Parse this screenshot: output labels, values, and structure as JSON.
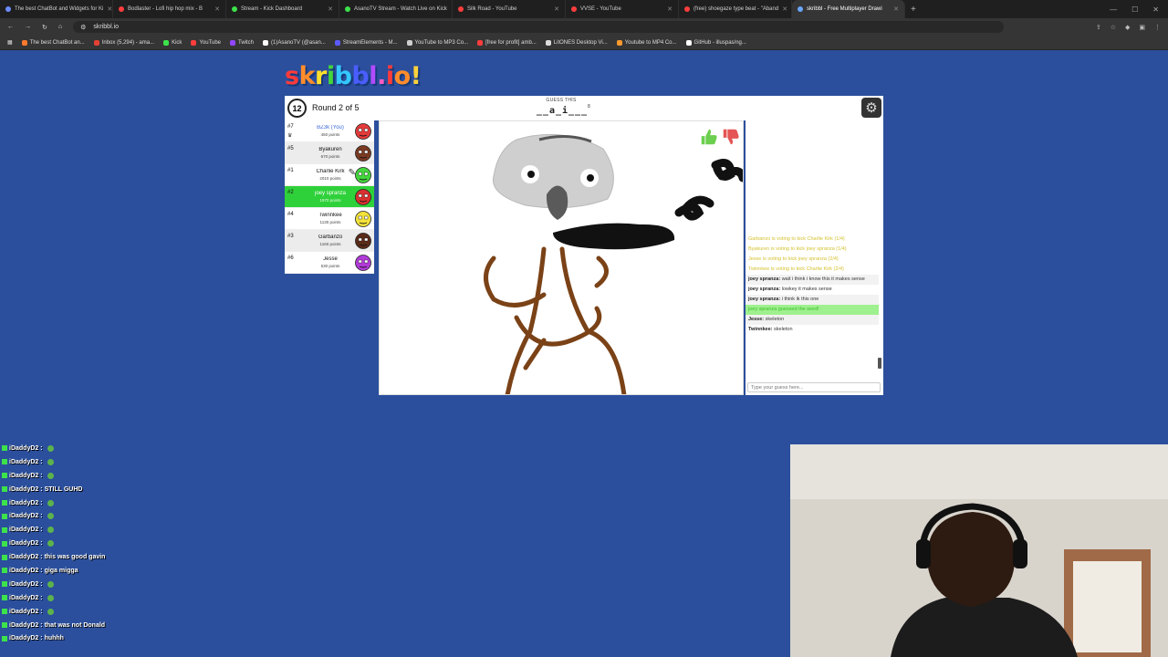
{
  "browser": {
    "tabs": [
      {
        "label": "The best ChatBot and Widgets for Ki",
        "color": "#6c8cff"
      },
      {
        "label": "Bodlaster - Lofi hip hop mix - B",
        "color": "#ff3d3d"
      },
      {
        "label": "Stream - Kick Dashboard",
        "color": "#3de24b"
      },
      {
        "label": "AsanoTV Stream - Watch Live on Kick",
        "color": "#3de24b"
      },
      {
        "label": "Silk Road - YouTube",
        "color": "#ff3d3d"
      },
      {
        "label": "VVSE - YouTube",
        "color": "#ff3d3d"
      },
      {
        "label": "(free) shoegaze type beat - \"Aband",
        "color": "#ff3d3d"
      },
      {
        "label": "skribbl - Free Multiplayer Drawi",
        "color": "#6aa7ff"
      }
    ],
    "url": "skribbl.io",
    "bookmarks": [
      {
        "label": "The best ChatBot an...",
        "color": "#ff7a2f"
      },
      {
        "label": "Inbox (5,294) - ama...",
        "color": "#e34133"
      },
      {
        "label": "Kick",
        "color": "#3de24b"
      },
      {
        "label": "YouTube",
        "color": "#ff3d3d"
      },
      {
        "label": "Twitch",
        "color": "#9146ff"
      },
      {
        "label": "(1)AsanoTV (@asan...",
        "color": "#ffffff"
      },
      {
        "label": "StreamElements - M...",
        "color": "#5b5bff"
      },
      {
        "label": "YouTube to MP3 Co...",
        "color": "#cfcfcf"
      },
      {
        "label": "[free for profit] amb...",
        "color": "#ff3d3d"
      },
      {
        "label": "LitONES Desktop Vi...",
        "color": "#dddddd"
      },
      {
        "label": "Youtube to MP4 Co...",
        "color": "#ff9a2f"
      },
      {
        "label": "GitHub - illuspas/ng...",
        "color": "#ffffff"
      }
    ]
  },
  "game": {
    "logo": "skribbl.io",
    "logo_suffix": "!",
    "logo_colors": [
      "#ff3b3b",
      "#ff8c2b",
      "#ffe02b",
      "#43d63c",
      "#34c7ff",
      "#4a5dff",
      "#b14bff",
      "#ff5cc4",
      "#ff3b3b",
      "#ff8c2b"
    ],
    "timer": "12",
    "round": "Round 2 of 5",
    "guess_label": "GUESS THIS",
    "guess_word": "__a_i___",
    "word_length": "8",
    "players": [
      {
        "rank": "#7",
        "name": "BZ3k (You)",
        "points": "450 points",
        "avatar_color": "#e43b3b",
        "me": true
      },
      {
        "rank": "#5",
        "name": "Byakuren",
        "points": "670 points",
        "avatar_color": "#7a3b22"
      },
      {
        "rank": "#1",
        "name": "Charlie Kirk",
        "points": "2010 points",
        "avatar_color": "#43d63c",
        "drawing": true
      },
      {
        "rank": "#2",
        "name": "joey spranza",
        "points": "1970 points",
        "avatar_color": "#d93030",
        "guessed": true
      },
      {
        "rank": "#4",
        "name": "Twinnkee",
        "points": "1130 points",
        "avatar_color": "#f2e23a"
      },
      {
        "rank": "#3",
        "name": "Garbanzo",
        "points": "1160 points",
        "avatar_color": "#5a2b19"
      },
      {
        "rank": "#6",
        "name": "Jesse",
        "points": "530 points",
        "avatar_color": "#b23ad9"
      }
    ],
    "chat": [
      {
        "type": "system",
        "text": "Garbanzo is voting to kick Charlie Kirk (1/4)"
      },
      {
        "type": "system",
        "text": "Byakuren is voting to kick joey spranza (1/4)"
      },
      {
        "type": "system",
        "text": "Jesse is voting to kick joey spranza (2/4)"
      },
      {
        "type": "system",
        "text": "Twinnkee is voting to kick Charlie Kirk (2/4)"
      },
      {
        "type": "msg",
        "name": "joey spranza:",
        "text": "wait i think i know this it makes sense"
      },
      {
        "type": "msg",
        "name": "joey spranza:",
        "text": "lowkey it makes sense"
      },
      {
        "type": "msg",
        "name": "joey spranza:",
        "text": "i think ik this one"
      },
      {
        "type": "guessed",
        "text": "joey spranza guessed the word!"
      },
      {
        "type": "msg",
        "name": "Jesse:",
        "text": "skeleton"
      },
      {
        "type": "msg",
        "name": "Twinnkee:",
        "text": "skeleton"
      }
    ],
    "chat_placeholder": "Type your guess here..."
  },
  "stream_chat": [
    {
      "user": "iDaddyD2 :",
      "text": "",
      "emote": true
    },
    {
      "user": "iDaddyD2 :",
      "text": "",
      "emote": true
    },
    {
      "user": "iDaddyD2 :",
      "text": "",
      "emote": true
    },
    {
      "user": "iDaddyD2 :",
      "text": "STILL GUHD",
      "emote": false
    },
    {
      "user": "iDaddyD2 :",
      "text": "",
      "emote": true
    },
    {
      "user": "iDaddyD2 :",
      "text": "",
      "emote": true
    },
    {
      "user": "iDaddyD2 :",
      "text": "",
      "emote": true
    },
    {
      "user": "iDaddyD2 :",
      "text": "",
      "emote": true
    },
    {
      "user": "iDaddyD2 :",
      "text": "this was good gavin",
      "emote": false
    },
    {
      "user": "iDaddyD2 :",
      "text": "giga migga",
      "emote": false
    },
    {
      "user": "iDaddyD2 :",
      "text": "",
      "emote": true
    },
    {
      "user": "iDaddyD2 :",
      "text": "",
      "emote": true
    },
    {
      "user": "iDaddyD2 :",
      "text": "",
      "emote": true
    },
    {
      "user": "iDaddyD2 :",
      "text": "that was not Donald",
      "emote": false
    },
    {
      "user": "iDaddyD2 :",
      "text": "huhhh",
      "emote": false
    }
  ]
}
